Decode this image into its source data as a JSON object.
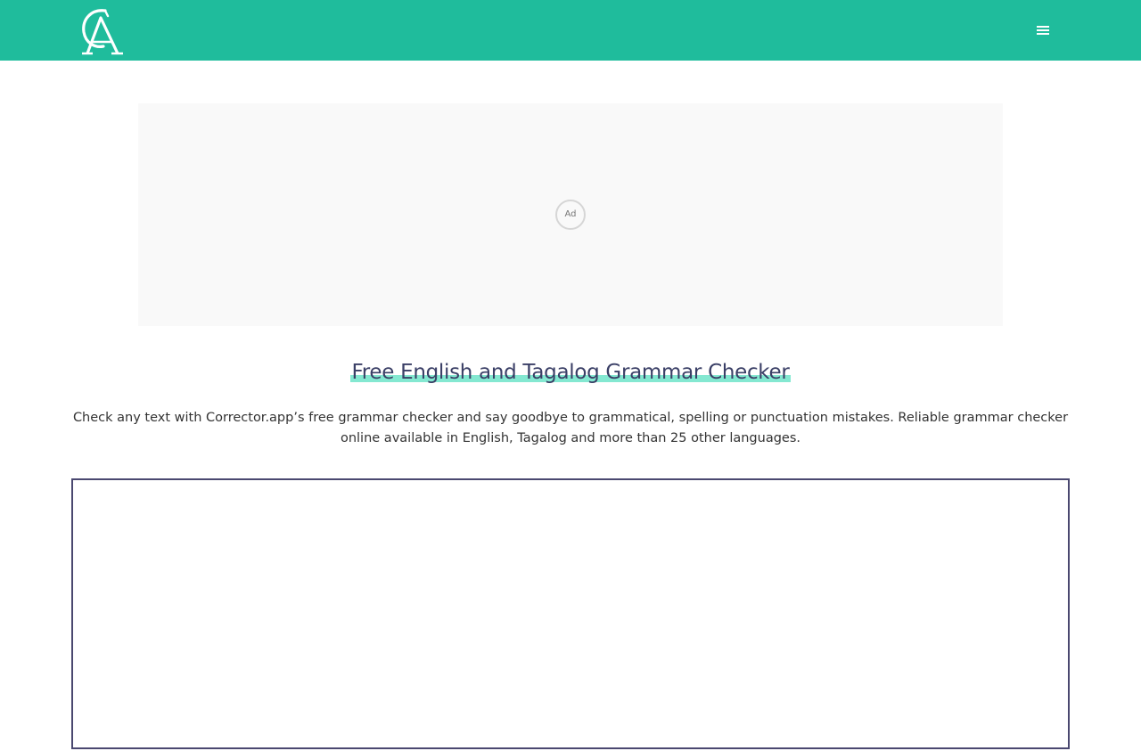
{
  "header": {
    "background_color": "#1fbc9c",
    "logo_icon": "corrector-ca-monogram-icon",
    "menu_icon": "hamburger-menu-icon"
  },
  "ad": {
    "badge_label": "Ad",
    "background_color": "#f9f9f9"
  },
  "hero": {
    "title": "Free English and Tagalog Grammar Checker",
    "title_color": "#3a3f66",
    "highlight_color": "#84e8d1",
    "description": "Check any text with Corrector.app’s free grammar checker and say goodbye to grammatical, spelling or punctuation mistakes. Reliable grammar checker online available in English, Tagalog and more than 25 other languages."
  },
  "editor": {
    "value": "",
    "border_color": "#4a4870"
  }
}
